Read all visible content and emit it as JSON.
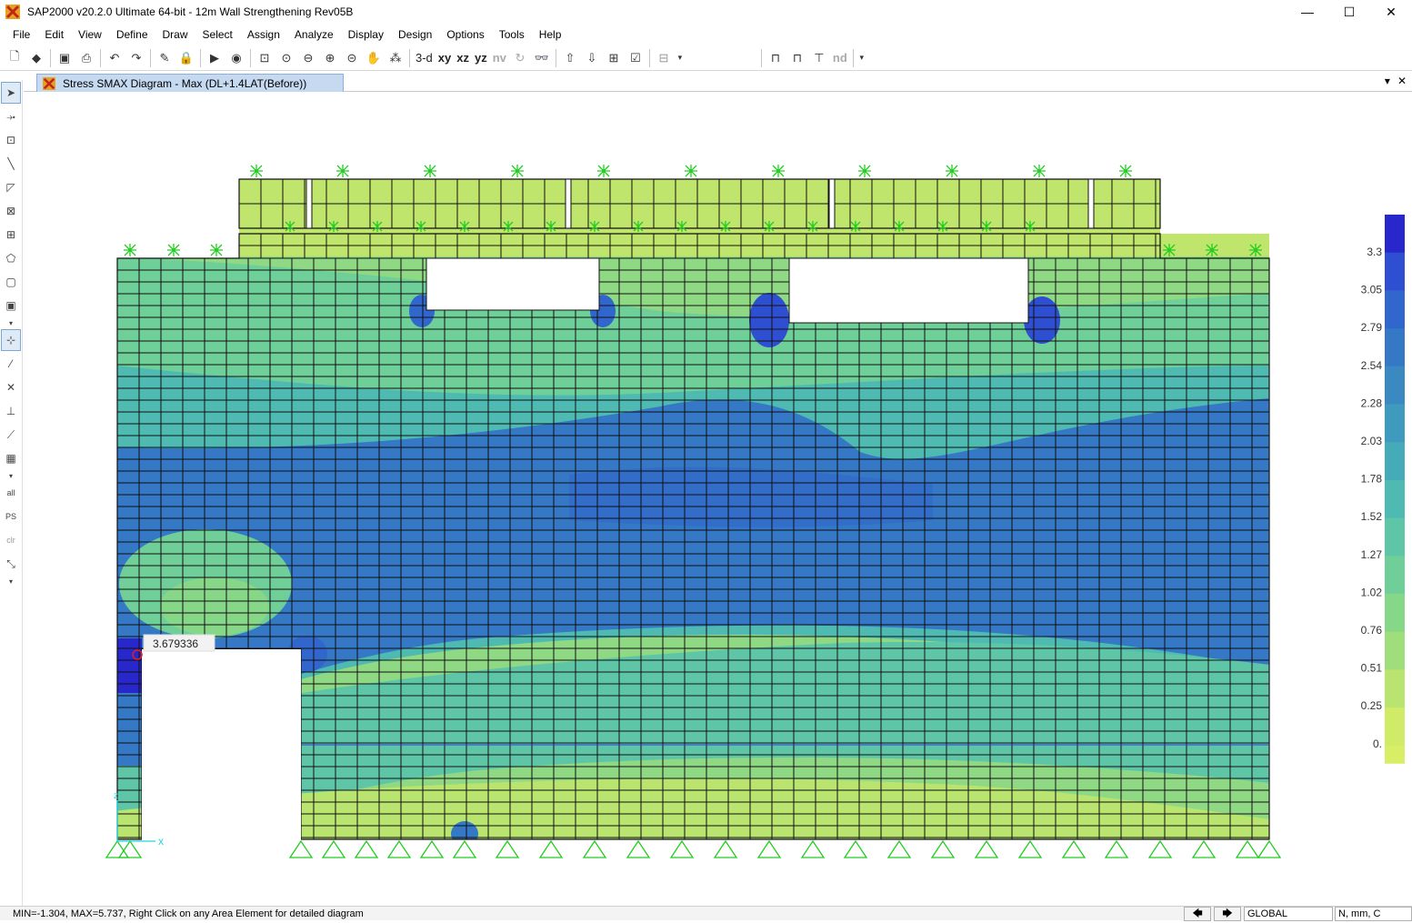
{
  "window": {
    "title": "SAP2000 v20.2.0 Ultimate 64-bit - 12m Wall Strengthening Rev05B",
    "minimize": "—",
    "maximize": "☐",
    "close": "✕"
  },
  "menu": [
    "File",
    "Edit",
    "View",
    "Define",
    "Draw",
    "Select",
    "Assign",
    "Analyze",
    "Display",
    "Design",
    "Options",
    "Tools",
    "Help"
  ],
  "toolbar": {
    "view_3d": "3-d",
    "view_xy": "xy",
    "view_xz": "xz",
    "view_yz": "yz",
    "view_nv": "nv",
    "nd": "nd"
  },
  "left_tools": {
    "all": "all",
    "ps": "PS",
    "clr": "clr"
  },
  "tab": {
    "title": "Stress SMAX Diagram - Max   (DL+1.4LAT(Before))",
    "dropdown": "▾",
    "close": "✕"
  },
  "diagram": {
    "probe_value": "3.679336",
    "axis_x": "x",
    "axis_z": "z",
    "legend": {
      "labels": [
        "3.3",
        "3.05",
        "2.79",
        "2.54",
        "2.28",
        "2.03",
        "1.78",
        "1.52",
        "1.27",
        "1.02",
        "0.76",
        "0.51",
        "0.25",
        "0."
      ],
      "colors": [
        "#2727cc",
        "#2e4fd1",
        "#3166cc",
        "#3478c6",
        "#3a89c1",
        "#3f9abd",
        "#46abb8",
        "#4fbab1",
        "#5ec6a6",
        "#70cf98",
        "#86d788",
        "#9fde7a",
        "#b8e46f",
        "#d0eb68"
      ],
      "min_value": -1.304,
      "max_value": 5.737
    }
  },
  "status": {
    "message": "MIN=-1.304, MAX=5.737, Right Click on any Area Element for detailed diagram",
    "coord_system": "GLOBAL",
    "units": "N, mm, C"
  }
}
